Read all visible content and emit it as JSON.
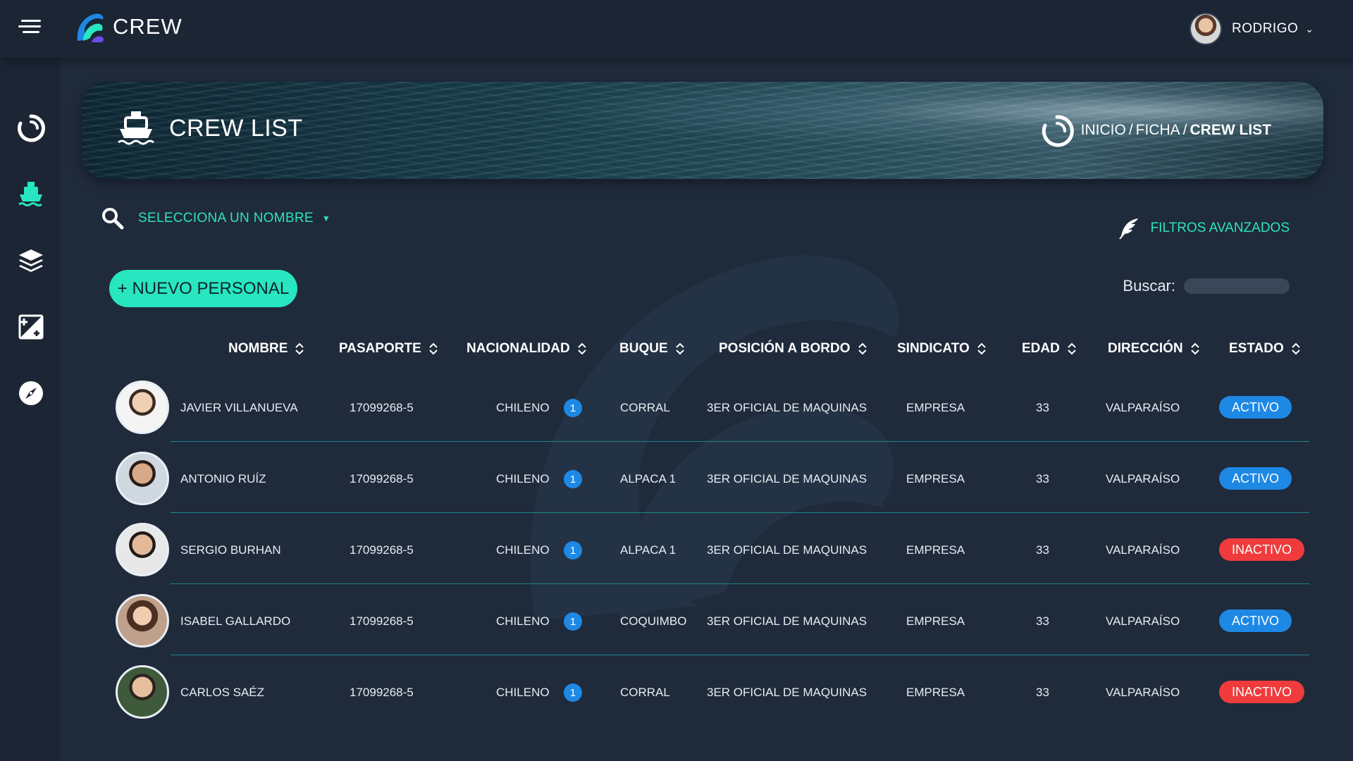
{
  "app": {
    "name": "CREW"
  },
  "user": {
    "name": "RODRIGO"
  },
  "sidebar": {
    "items": [
      {
        "icon": "sync-icon"
      },
      {
        "icon": "ship-icon",
        "active": true
      },
      {
        "icon": "layers-icon"
      },
      {
        "icon": "image-add-icon"
      },
      {
        "icon": "compass-icon"
      }
    ]
  },
  "banner": {
    "title": "CREW LIST",
    "breadcrumb": [
      "INICIO",
      "FICHA",
      "CREW LIST"
    ]
  },
  "controls": {
    "select_name_label": "SELECCIONA UN NOMBRE",
    "advanced_filters_label": "FILTROS AVANZADOS",
    "new_button_label": "+ NUEVO PERSONAL",
    "search_label": "Buscar:",
    "search_value": ""
  },
  "table": {
    "columns": [
      "NOMBRE",
      "PASAPORTE",
      "NACIONALIDAD",
      "BUQUE",
      "POSICIÓN A BORDO",
      "SINDICATO",
      "EDAD",
      "DIRECCIÓN",
      "ESTADO"
    ],
    "rows": [
      {
        "nombre": "JAVIER VILLANUEVA",
        "pasaporte": "17099268-5",
        "nacionalidad": "CHILENO",
        "count": "1",
        "buque": "CORRAL",
        "posicion": "3ER OFICIAL DE MAQUINAS",
        "sindicato": "EMPRESA",
        "edad": "33",
        "direccion": "VALPARAÍSO",
        "estado": "ACTIVO"
      },
      {
        "nombre": "ANTONIO RUÍZ",
        "pasaporte": "17099268-5",
        "nacionalidad": "CHILENO",
        "count": "1",
        "buque": "ALPACA 1",
        "posicion": "3ER OFICIAL DE MAQUINAS",
        "sindicato": "EMPRESA",
        "edad": "33",
        "direccion": "VALPARAÍSO",
        "estado": "ACTIVO"
      },
      {
        "nombre": "SERGIO BURHAN",
        "pasaporte": "17099268-5",
        "nacionalidad": "CHILENO",
        "count": "1",
        "buque": "ALPACA 1",
        "posicion": "3ER OFICIAL DE MAQUINAS",
        "sindicato": "EMPRESA",
        "edad": "33",
        "direccion": "VALPARAÍSO",
        "estado": "INACTIVO"
      },
      {
        "nombre": "ISABEL GALLARDO",
        "pasaporte": "17099268-5",
        "nacionalidad": "CHILENO",
        "count": "1",
        "buque": "COQUIMBO",
        "posicion": "3ER OFICIAL DE MAQUINAS",
        "sindicato": "EMPRESA",
        "edad": "33",
        "direccion": "VALPARAÍSO",
        "estado": "ACTIVO"
      },
      {
        "nombre": "CARLOS SAÉZ",
        "pasaporte": "17099268-5",
        "nacionalidad": "CHILENO",
        "count": "1",
        "buque": "CORRAL",
        "posicion": "3ER OFICIAL DE MAQUINAS",
        "sindicato": "EMPRESA",
        "edad": "33",
        "direccion": "VALPARAÍSO",
        "estado": "INACTIVO"
      }
    ]
  },
  "colors": {
    "accent": "#27e6c0",
    "active": "#1e88e5",
    "inactive": "#ef3b3b",
    "background": "#1f2a3b"
  }
}
